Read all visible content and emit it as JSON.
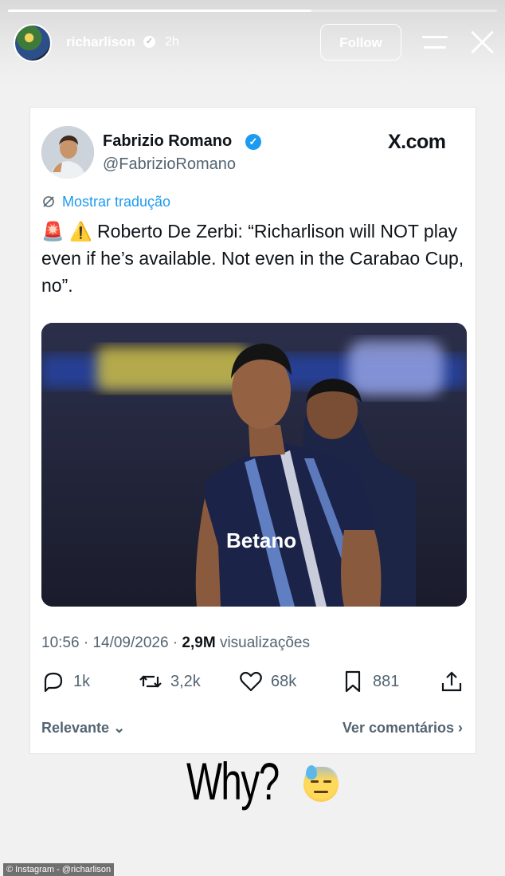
{
  "story": {
    "username": "richarlison",
    "time": "2h",
    "follow_label": "Follow",
    "progress": 0.62
  },
  "tweet": {
    "author_name": "Fabrizio Romano",
    "author_handle": "@FabrizioRomano",
    "brand": "X.com",
    "translate_label": "Mostrar tradução",
    "text": "🚨 ⚠️ Roberto De Zerbi: “Richarlison will NOT play even if he’s available. Not even in the Carabao Cup, no”.",
    "time": "10:56",
    "date": "14/09/2026",
    "views_count": "2,9M",
    "views_label": "visualizações",
    "replies": "1k",
    "retweets": "3,2k",
    "likes": "68k",
    "bookmarks": "881",
    "sort_label": "Relevante",
    "comments_link": "Ver comentários",
    "jersey_sponsor": "Betano"
  },
  "caption": {
    "text": "Why?",
    "emoji": "sweat-face-emoji"
  },
  "credit": "© Instagram - @richarlison",
  "colors": {
    "accent": "#1d9bf0",
    "text": "#0f1419",
    "muted": "#536471"
  }
}
